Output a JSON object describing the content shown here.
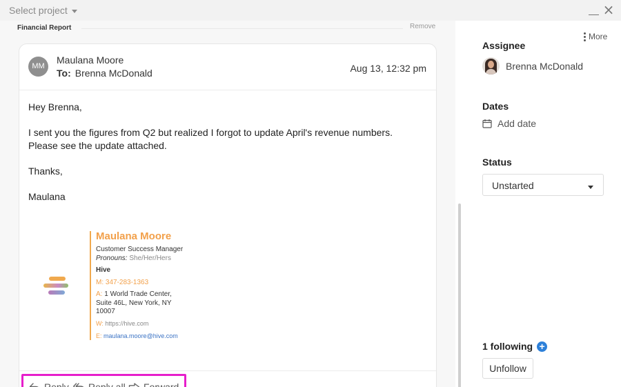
{
  "topbar": {
    "project_select": "Select project"
  },
  "thread": {
    "title": "Financial Report",
    "remove": "Remove"
  },
  "email": {
    "avatar_initials": "MM",
    "sender": "Maulana Moore",
    "to_label": "To:",
    "recipient": "Brenna McDonald",
    "date": "Aug 13, 12:32 pm",
    "body": [
      "Hey Brenna,",
      "I sent you the figures from Q2 but realized I forgot to update April's revenue numbers. Please see the update attached.",
      "Thanks,",
      "Maulana"
    ],
    "signature": {
      "name": "Maulana Moore",
      "title": "Customer Success Manager",
      "pronouns_label": "Pronouns:",
      "pronouns": "She/Her/Hers",
      "company": "Hive",
      "phone_key": "M:",
      "phone": "347-283-1363",
      "address_key": "A:",
      "address": "1 World Trade Center, Suite 46L, New York, NY 10007",
      "web_key": "W:",
      "web": "https://hive.com",
      "email_key": "E:",
      "email": "maulana.moore@hive.com"
    },
    "actions": {
      "reply": "Reply",
      "reply_all": "Reply all",
      "forward": "Forward"
    }
  },
  "sidebar": {
    "more": "More",
    "assignee_label": "Assignee",
    "assignee_name": "Brenna McDonald",
    "dates_label": "Dates",
    "add_date": "Add date",
    "status_label": "Status",
    "status_value": "Unstarted",
    "following": "1 following",
    "unfollow": "Unfollow"
  },
  "colors": {
    "accent": "#f2a04a",
    "highlight": "#e61ecb",
    "link": "#2d80d9"
  }
}
